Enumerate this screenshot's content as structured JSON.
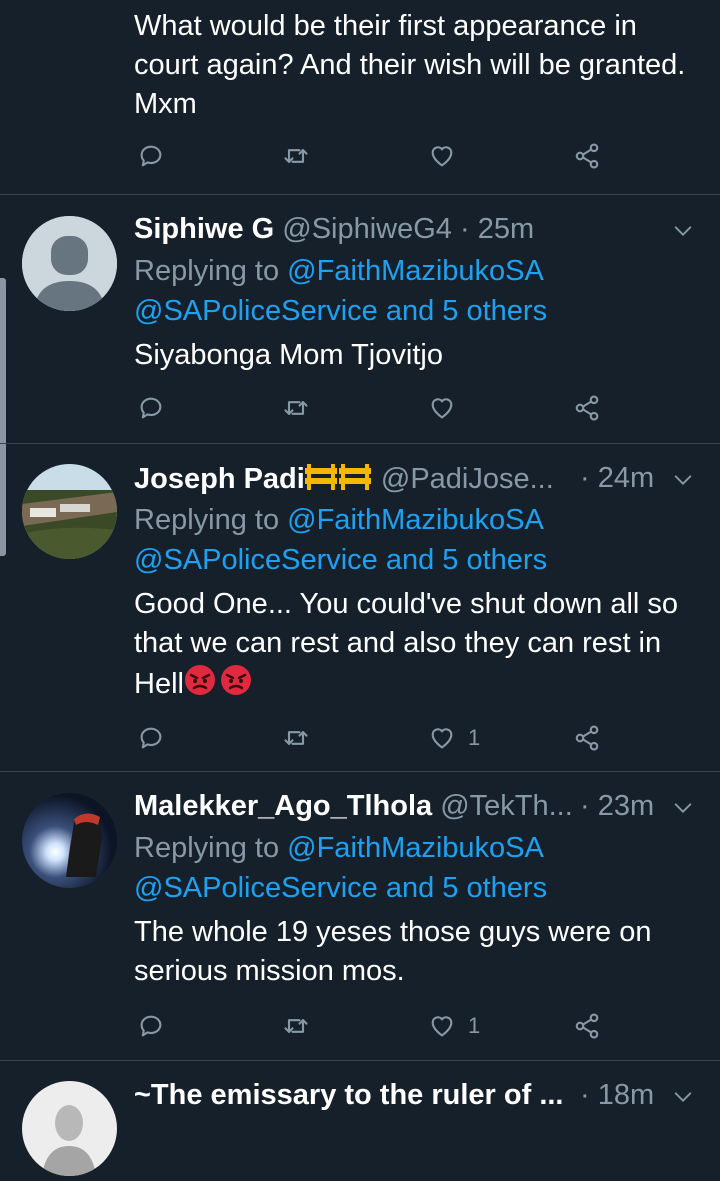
{
  "tweets": [
    {
      "text": "What would be their first appearance in court again? And their wish will be granted. Mxm",
      "actions": {
        "reply_count": "",
        "retweet_count": "",
        "like_count": ""
      }
    },
    {
      "name": "Siphiwe G",
      "handle": "@SiphiweG4",
      "sep": "·",
      "time": "25m",
      "replying_prefix": "Replying to ",
      "replying_to": "@FaithMazibukoSA",
      "replying_others": "@SAPoliceService and 5 others",
      "text": "Siyabonga Mom Tjovitjo",
      "actions": {
        "like_count": ""
      }
    },
    {
      "name": "Joseph Padi",
      "name_emoji": "construction-barrier-emoji",
      "handle": "@PadiJose...",
      "sep": "·",
      "time": "24m",
      "replying_prefix": "Replying to ",
      "replying_to": "@FaithMazibukoSA",
      "replying_others": "@SAPoliceService and 5 others",
      "text": "Good One... You could've shut down all so that we can rest and also they can rest in Hell",
      "text_emoji": "angry-face-emoji",
      "actions": {
        "like_count": "1"
      }
    },
    {
      "name": "Malekker_Ago_Tlhola",
      "handle": "@TekTh...",
      "sep": "·",
      "time": "23m",
      "replying_prefix": "Replying to ",
      "replying_to": "@FaithMazibukoSA",
      "replying_others": "@SAPoliceService and 5 others",
      "text": "The whole 19 yeses those guys were on serious mission mos.",
      "actions": {
        "like_count": "1"
      }
    },
    {
      "name": "~The emissary to the ruler of ...",
      "sep": "·",
      "time": "18m"
    }
  ],
  "colors": {
    "background": "#15202b",
    "divider": "#38444d",
    "secondary_text": "#8899a6",
    "link": "#1da1f2",
    "angry_emoji": "#e0293f",
    "barrier_emoji": "#f5b700"
  }
}
